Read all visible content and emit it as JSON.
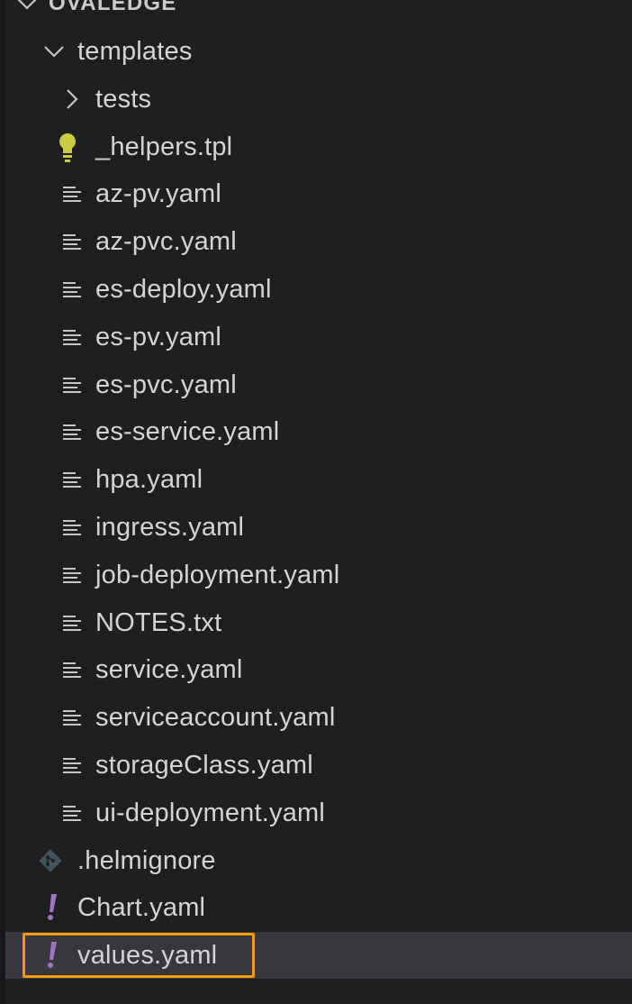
{
  "explorer": {
    "root": {
      "label": "OVALEDGE"
    },
    "folder": {
      "label": "templates"
    },
    "subfolder": {
      "label": "tests"
    },
    "files": [
      {
        "label": "_helpers.tpl",
        "icon": "lightbulb-icon"
      },
      {
        "label": "az-pv.yaml",
        "icon": "text-lines-icon"
      },
      {
        "label": "az-pvc.yaml",
        "icon": "text-lines-icon"
      },
      {
        "label": "es-deploy.yaml",
        "icon": "text-lines-icon"
      },
      {
        "label": "es-pv.yaml",
        "icon": "text-lines-icon"
      },
      {
        "label": "es-pvc.yaml",
        "icon": "text-lines-icon"
      },
      {
        "label": "es-service.yaml",
        "icon": "text-lines-icon"
      },
      {
        "label": "hpa.yaml",
        "icon": "text-lines-icon"
      },
      {
        "label": "ingress.yaml",
        "icon": "text-lines-icon"
      },
      {
        "label": "job-deployment.yaml",
        "icon": "text-lines-icon"
      },
      {
        "label": "NOTES.txt",
        "icon": "text-lines-icon"
      },
      {
        "label": "service.yaml",
        "icon": "text-lines-icon"
      },
      {
        "label": "serviceaccount.yaml",
        "icon": "text-lines-icon"
      },
      {
        "label": "storageClass.yaml",
        "icon": "text-lines-icon"
      },
      {
        "label": "ui-deployment.yaml",
        "icon": "text-lines-icon"
      }
    ],
    "root_files": [
      {
        "label": ".helmignore",
        "icon": "git-icon"
      },
      {
        "label": "Chart.yaml",
        "icon": "exclamation-icon"
      },
      {
        "label": "values.yaml",
        "icon": "exclamation-icon",
        "selected": true
      }
    ]
  },
  "colors": {
    "background": "#1f1f1f",
    "text": "#d4d4d4",
    "selection_background": "#37373d",
    "selection_outline": "#f29b0c",
    "yaml_exclamation": "#a074c4",
    "lightbulb": "#cbcb41",
    "git_icon": "#41535b"
  }
}
